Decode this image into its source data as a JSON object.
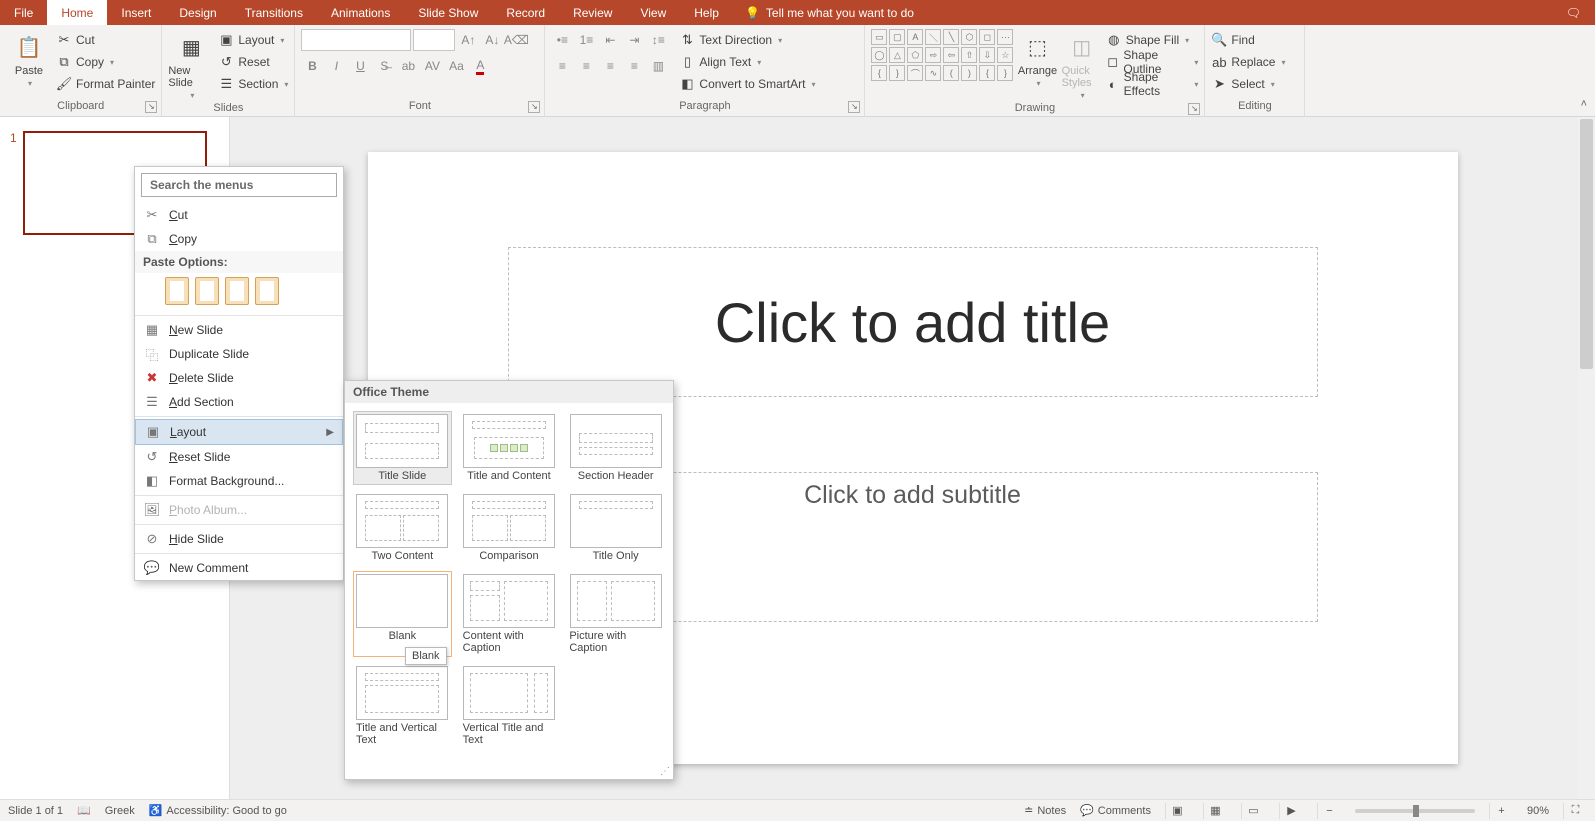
{
  "ribbon": {
    "tabs": [
      "File",
      "Home",
      "Insert",
      "Design",
      "Transitions",
      "Animations",
      "Slide Show",
      "Record",
      "Review",
      "View",
      "Help"
    ],
    "active_tab": "Home",
    "tell_me": "Tell me what you want to do",
    "groups": {
      "clipboard": {
        "label": "Clipboard",
        "paste": "Paste",
        "cut": "Cut",
        "copy": "Copy",
        "format_painter": "Format Painter"
      },
      "slides": {
        "label": "Slides",
        "new_slide": "New Slide",
        "layout": "Layout",
        "reset": "Reset",
        "section": "Section"
      },
      "font": {
        "label": "Font"
      },
      "paragraph": {
        "label": "Paragraph",
        "text_direction": "Text Direction",
        "align_text": "Align Text",
        "smartart": "Convert to SmartArt"
      },
      "drawing": {
        "label": "Drawing",
        "arrange": "Arrange",
        "quick_styles": "Quick Styles",
        "shape_fill": "Shape Fill",
        "shape_outline": "Shape Outline",
        "shape_effects": "Shape Effects"
      },
      "editing": {
        "label": "Editing",
        "find": "Find",
        "replace": "Replace",
        "select": "Select"
      }
    }
  },
  "context_menu": {
    "search_placeholder": "Search the menus",
    "cut": "Cut",
    "copy": "Copy",
    "paste_hdr": "Paste Options:",
    "new_slide": "New Slide",
    "duplicate": "Duplicate Slide",
    "delete": "Delete Slide",
    "add_section": "Add Section",
    "layout": "Layout",
    "reset": "Reset Slide",
    "format_bg": "Format Background...",
    "photo_album": "Photo Album...",
    "hide": "Hide Slide",
    "new_comment": "New Comment"
  },
  "layout_flyout": {
    "header": "Office Theme",
    "items": [
      "Title Slide",
      "Title and Content",
      "Section Header",
      "Two Content",
      "Comparison",
      "Title Only",
      "Blank",
      "Content with Caption",
      "Picture with Caption",
      "Title and Vertical Text",
      "Vertical Title and Text"
    ],
    "tooltip": "Blank"
  },
  "slide": {
    "title_ph": "Click to add title",
    "subtitle_ph": "Click to add subtitle",
    "thumb_num": "1"
  },
  "status": {
    "slide": "Slide 1 of 1",
    "lang": "Greek",
    "a11y": "Accessibility: Good to go",
    "notes": "Notes",
    "comments": "Comments",
    "zoom": "90%"
  }
}
